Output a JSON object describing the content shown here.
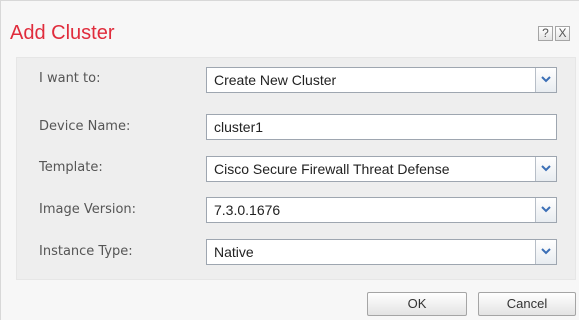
{
  "dialog": {
    "title": "Add Cluster",
    "help_label": "?",
    "close_label": "X"
  },
  "form": {
    "i_want_to": {
      "label": "I want to:",
      "value": "Create New Cluster"
    },
    "device_name": {
      "label": "Device Name:",
      "value": "cluster1"
    },
    "template": {
      "label": "Template:",
      "value": "Cisco Secure Firewall Threat Defense"
    },
    "image_version": {
      "label": "Image Version:",
      "value": "7.3.0.1676"
    },
    "instance_type": {
      "label": "Instance Type:",
      "value": "Native"
    }
  },
  "buttons": {
    "ok": "OK",
    "cancel": "Cancel"
  },
  "colors": {
    "title": "#e02c3c",
    "dropdown_arrow": "#3b6fb6"
  },
  "icons": [
    "help-icon",
    "close-icon",
    "chevron-down-icon"
  ]
}
